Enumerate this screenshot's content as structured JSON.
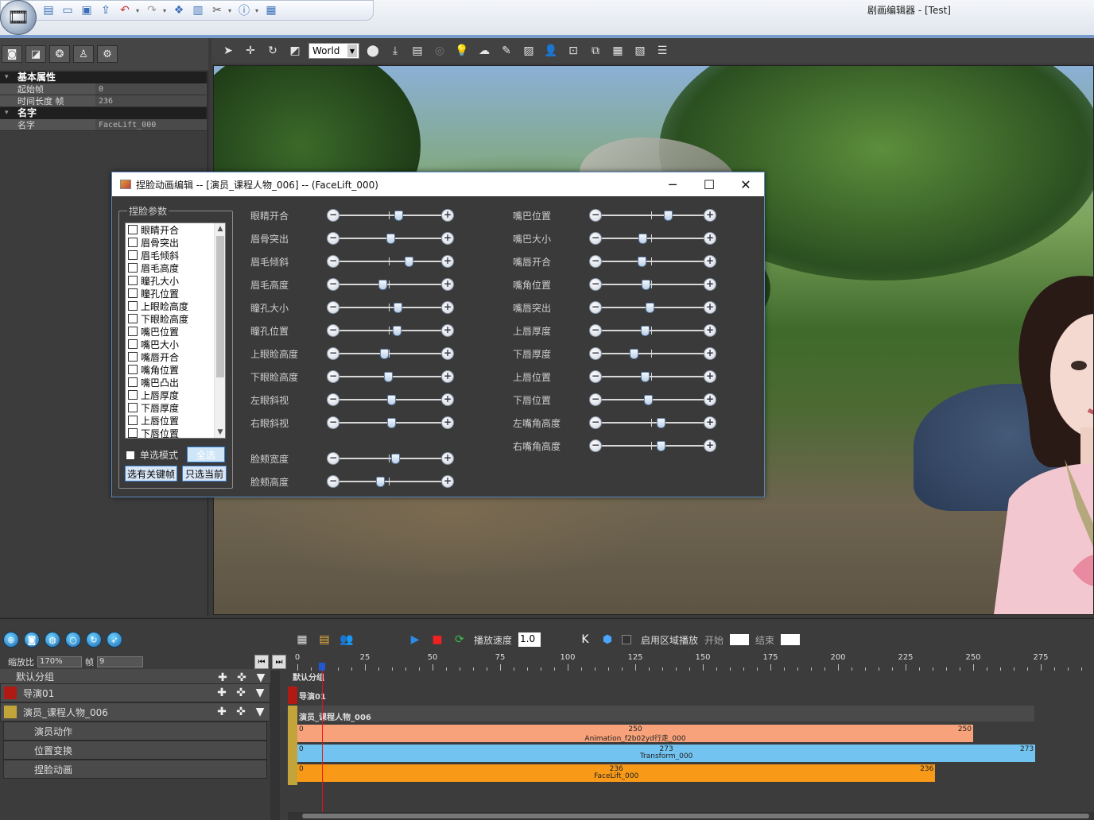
{
  "window": {
    "title": "剧画编辑器 - [Test]"
  },
  "top_toolbar": {
    "icons": [
      "new-file-icon",
      "open-folder-icon",
      "save-icon",
      "export-icon",
      "undo-icon",
      "redo-icon",
      "assets-icon",
      "layout-icon",
      "tools-icon",
      "info-icon",
      "window-icon"
    ]
  },
  "left_panel": {
    "tools": [
      "camera-icon",
      "slash-icon",
      "effect-icon",
      "person-icon",
      "circle-icon"
    ],
    "groups": [
      {
        "name": "基本属性",
        "rows": [
          {
            "key": "起始帧",
            "value": "0"
          },
          {
            "key": "时间长度 帧",
            "value": "236"
          }
        ]
      },
      {
        "name": "名字",
        "rows": [
          {
            "key": "名字",
            "value": "FaceLift_000"
          }
        ]
      }
    ]
  },
  "viewport_toolbar": {
    "space_select": "World"
  },
  "dialog": {
    "title": "捏脸动画编辑  -- [演员_课程人物_006] -- (FaceLift_000)",
    "group_label": "捏脸参数",
    "checklist": [
      "眼睛开合",
      "眉骨突出",
      "眉毛倾斜",
      "眉毛高度",
      "瞳孔大小",
      "瞳孔位置",
      "上眼睑高度",
      "下眼睑高度",
      "嘴巴位置",
      "嘴巴大小",
      "嘴唇开合",
      "嘴角位置",
      "嘴巴凸出",
      "上唇厚度",
      "下唇厚度",
      "上唇位置",
      "下唇位置"
    ],
    "single_mode_label": "单选模式",
    "select_all": "全选",
    "select_keyframes": "选有关键帧",
    "select_current": "只选当前",
    "sliders_left": [
      {
        "label": "眼睛开合",
        "value": 0.58
      },
      {
        "label": "眉骨突出",
        "value": 0.5
      },
      {
        "label": "眉毛倾斜",
        "value": 0.68
      },
      {
        "label": "眉毛高度",
        "value": 0.42
      },
      {
        "label": "瞳孔大小",
        "value": 0.57
      },
      {
        "label": "瞳孔位置",
        "value": 0.56
      },
      {
        "label": "上眼睑高度",
        "value": 0.44
      },
      {
        "label": "下眼睑高度",
        "value": 0.48
      },
      {
        "label": "左眼斜视",
        "value": 0.51
      },
      {
        "label": "右眼斜视",
        "value": 0.51
      },
      {
        "label": "脸颊宽度",
        "value": 0.55
      },
      {
        "label": "脸颊高度",
        "value": 0.4
      }
    ],
    "sliders_right": [
      {
        "label": "嘴巴位置",
        "value": 0.65
      },
      {
        "label": "嘴巴大小",
        "value": 0.4
      },
      {
        "label": "嘴唇开合",
        "value": 0.39
      },
      {
        "label": "嘴角位置",
        "value": 0.43
      },
      {
        "label": "嘴唇突出",
        "value": 0.47
      },
      {
        "label": "上唇厚度",
        "value": 0.42
      },
      {
        "label": "下唇厚度",
        "value": 0.31
      },
      {
        "label": "上唇位置",
        "value": 0.42
      },
      {
        "label": "下唇位置",
        "value": 0.45
      },
      {
        "label": "左嘴角高度",
        "value": 0.58
      },
      {
        "label": "右嘴角高度",
        "value": 0.58
      }
    ]
  },
  "bottom": {
    "zoom_label": "缩放比",
    "zoom_value": "170%",
    "frame_label": "帧",
    "frame_value": "9",
    "default_group": "默认分组",
    "director": "导演01",
    "actor": "演员_课程人物_006",
    "sub_tracks": [
      "演员动作",
      "位置变换",
      "捏脸动画"
    ],
    "speed_label": "播放速度",
    "speed_value": "1.0",
    "region_label": "启用区域播放",
    "start_label": "开始",
    "end_label": "结束",
    "ruler": [
      0,
      25,
      50,
      75,
      100,
      125,
      150,
      175,
      200,
      225,
      250,
      275
    ],
    "timeline_labels": {
      "group": "默认分组",
      "director": "导演01",
      "actor": "演员_课程人物_006"
    },
    "clips": [
      {
        "name": "Animation_f2b02yd行走_000",
        "start": 0,
        "end": 250,
        "mid": "250",
        "color": "#f7a27a"
      },
      {
        "name": "Transform_000",
        "start": 0,
        "end": 273,
        "mid": "273",
        "color": "#73c3f0"
      },
      {
        "name": "FaceLift_000",
        "start": 0,
        "end": 236,
        "mid": "236",
        "color": "#f89a18"
      }
    ],
    "playhead_frame": 9
  }
}
